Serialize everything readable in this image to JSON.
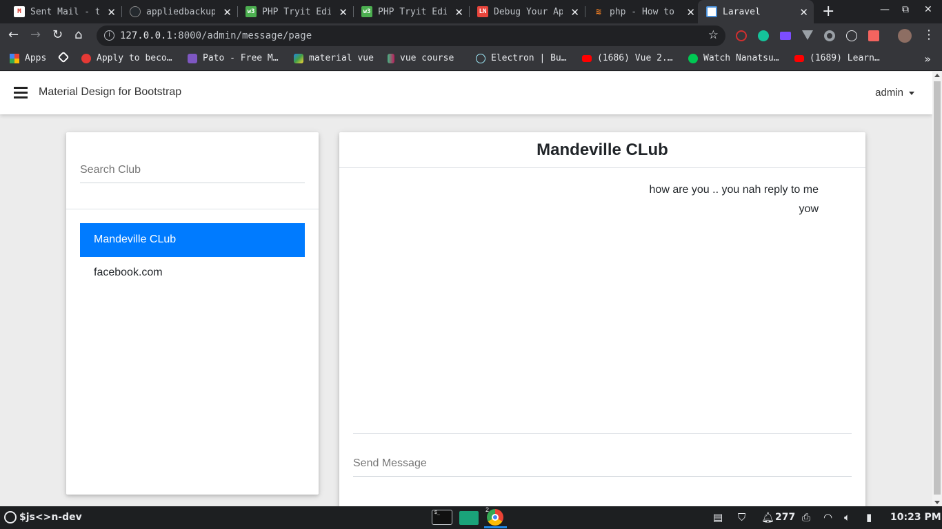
{
  "browser": {
    "tabs": [
      {
        "title": "Sent Mail - t",
        "icon": "gmail-icon",
        "color": "#d93025",
        "active": false
      },
      {
        "title": "appliedbackup",
        "icon": "github-icon",
        "color": "#24292e",
        "active": false
      },
      {
        "title": "PHP Tryit Edi",
        "icon": "w3schools-icon",
        "color": "#4caf50",
        "active": false
      },
      {
        "title": "PHP Tryit Edi",
        "icon": "w3schools-icon",
        "color": "#4caf50",
        "active": false
      },
      {
        "title": "Debug Your Ap",
        "icon": "logrocket-icon",
        "color": "#e8453c",
        "active": false
      },
      {
        "title": "php - How to",
        "icon": "stackoverflow-icon",
        "color": "#f48024",
        "active": false
      },
      {
        "title": "Laravel",
        "icon": "laravel-page-icon",
        "color": "#4a90d9",
        "active": true
      }
    ],
    "url_host": "127.0.0.1",
    "url_path": ":8000/admin/message/page",
    "bookmarks": [
      {
        "label": "Apps",
        "icon": "apps-grid-icon",
        "color": "#f44336"
      },
      {
        "label": "",
        "icon": "codepen-icon",
        "color": "#ffffff"
      },
      {
        "label": "Apply to beco…",
        "icon": "bookmark-red-icon",
        "color": "#e53935"
      },
      {
        "label": "Pato - Free M…",
        "icon": "colorlib-icon",
        "color": "#7e57c2"
      },
      {
        "label": "material vue",
        "icon": "vuetify-icon",
        "color": "#4caf50"
      },
      {
        "label": "vue course",
        "icon": "vuemastery-icon",
        "color": "#42b883"
      },
      {
        "label": "Electron | Bu…",
        "icon": "electron-icon",
        "color": "#9feaf9"
      },
      {
        "label": "(1686) Vue 2.…",
        "icon": "youtube-icon",
        "color": "#ff0000"
      },
      {
        "label": "Watch Nanatsu…",
        "icon": "tv-icon",
        "color": "#00c853"
      },
      {
        "label": "(1689) Learn…",
        "icon": "youtube-icon",
        "color": "#ff0000"
      }
    ]
  },
  "navbar": {
    "brand": "Material Design for Bootstrap",
    "user": "admin"
  },
  "sidebar": {
    "search_placeholder": "Search Club",
    "clubs": [
      {
        "name": "Mandeville CLub",
        "active": true
      },
      {
        "name": "facebook.com",
        "active": false
      }
    ]
  },
  "chat": {
    "title": "Mandeville CLub",
    "messages": [
      "how are you .. you nah reply to me",
      "yow"
    ],
    "send_placeholder": "Send Message"
  },
  "taskbar": {
    "launcher_label": "$js<>n-dev",
    "chrome_badge": "2",
    "notification_count": "277",
    "clock": "10:23 PM"
  },
  "colors": {
    "accent": "#007bff",
    "page_bg": "#ececec"
  }
}
